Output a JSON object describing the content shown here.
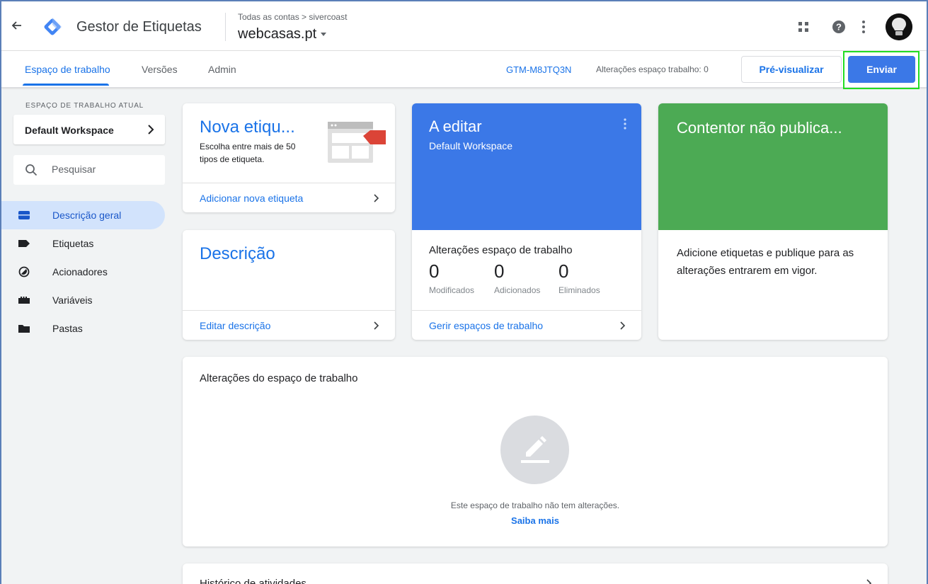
{
  "header": {
    "app_title": "Gestor de Etiquetas",
    "breadcrumb": "Todas as contas > sivercoast",
    "container_name": "webcasas.pt"
  },
  "tabs": [
    {
      "label": "Espaço de trabalho",
      "active": true
    },
    {
      "label": "Versões",
      "active": false
    },
    {
      "label": "Admin",
      "active": false
    }
  ],
  "toolbar": {
    "container_id": "GTM-M8JTQ3N",
    "changes_count": "Alterações espaço trabalho: 0",
    "preview_label": "Pré-visualizar",
    "submit_label": "Enviar"
  },
  "sidebar": {
    "workspace_label": "ESPAÇO DE TRABALHO ATUAL",
    "workspace_name": "Default Workspace",
    "search_placeholder": "Pesquisar",
    "items": [
      {
        "label": "Descrição geral",
        "icon": "overview-icon",
        "active": true
      },
      {
        "label": "Etiquetas",
        "icon": "tag-icon",
        "active": false
      },
      {
        "label": "Acionadores",
        "icon": "trigger-icon",
        "active": false
      },
      {
        "label": "Variáveis",
        "icon": "variable-icon",
        "active": false
      },
      {
        "label": "Pastas",
        "icon": "folder-icon",
        "active": false
      }
    ]
  },
  "cards": {
    "new_tag": {
      "title": "Nova etiqu...",
      "description": "Escolha entre mais de 50 tipos de etiqueta.",
      "link": "Adicionar nova etiqueta"
    },
    "description": {
      "title": "Descrição",
      "link": "Editar descrição"
    },
    "editing": {
      "title": "A editar",
      "workspace": "Default Workspace",
      "changes_title": "Alterações espaço de trabalho",
      "stats": [
        {
          "value": "0",
          "label": "Modificados"
        },
        {
          "value": "0",
          "label": "Adicionados"
        },
        {
          "value": "0",
          "label": "Eliminados"
        }
      ],
      "link": "Gerir espaços de trabalho"
    },
    "unpublished": {
      "title": "Contentor não publica...",
      "description": "Adicione etiquetas e publique para as alterações entrarem em vigor."
    },
    "workspace_changes": {
      "title": "Alterações do espaço de trabalho",
      "empty_text": "Este espaço de trabalho não tem alterações.",
      "learn_more": "Saiba mais"
    },
    "history": {
      "title": "Histórico de atividades"
    }
  },
  "colors": {
    "accent": "#1a73e8",
    "editing_card": "#3b78e7",
    "unpublished_card": "#4caa54",
    "highlight": "#22dd22"
  }
}
